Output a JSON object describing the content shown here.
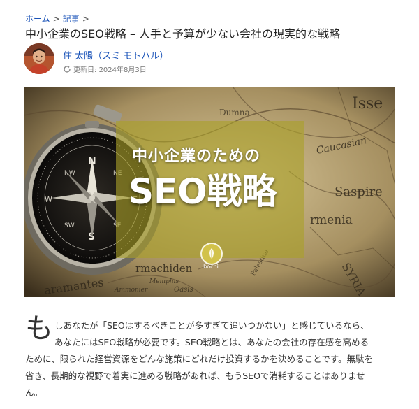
{
  "breadcrumb": {
    "home": "ホーム",
    "separator": ">",
    "articles": "記事"
  },
  "article": {
    "title": "中小企業のSEO戦略 – 人手と予算が少ない会社の現実的な戦略",
    "author": "住 太陽（スミ モトハル）",
    "updated_label": "更新日:",
    "updated_date": "2024年8月3日"
  },
  "hero": {
    "line1": "中小企業のための",
    "line2": "SEO戦略",
    "logo_text": "bochi"
  },
  "body": {
    "dropcap": "も",
    "lines": [
      "しあなたが「SEOはするべきことが多すぎて追いつかない」と感じているなら、",
      "あなたにはSEO戦略が必要です。SEO戦略とは、あなたの会社の存在感を高める",
      "ために、限られた経営資源をどんな施策にどれだけ投資するかを決めることです。無駄を",
      "省き、長期的な視野で着実に進める戦略があれば、もうSEOで消耗することはありませ",
      "ん。"
    ]
  },
  "colors": {
    "link": "#1a53b8",
    "hero_overlay": "#aaa028"
  },
  "icons": {
    "updated": "refresh-icon"
  }
}
